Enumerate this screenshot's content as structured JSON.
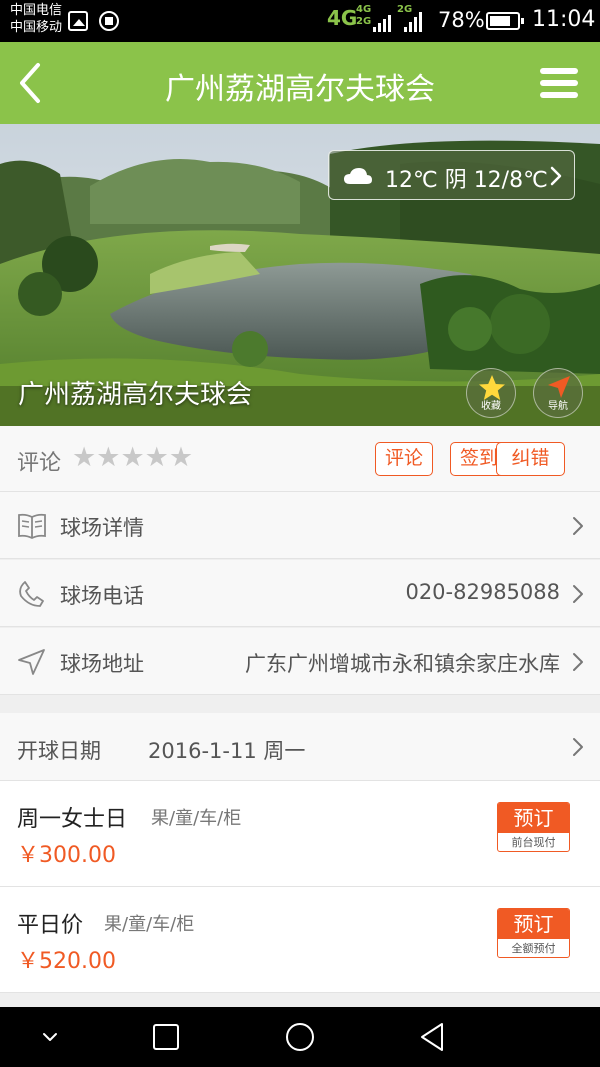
{
  "status_bar": {
    "carrier1": "中国电信",
    "carrier2": "中国移动",
    "network_main": "4G",
    "network_a": "4G",
    "network_b": "2G",
    "network_c": "2G",
    "battery_percent": "78%",
    "battery_level": 0.78,
    "time": "11:04"
  },
  "app_bar": {
    "title": "广州荔湖高尔夫球会",
    "back_icon": "back-arrow-icon",
    "menu_icon": "hamburger-menu-icon"
  },
  "hero": {
    "weather": "12℃  阴 12/8℃",
    "weather_icon": "cloud-icon",
    "course_name": "广州荔湖高尔夫球会",
    "favorite_label": "收藏",
    "navigate_label": "导航"
  },
  "rating": {
    "label": "评论",
    "stars": 0,
    "max_stars": 5,
    "comment_btn": "评论",
    "checkin_btn": "签到",
    "correct_btn": "纠错"
  },
  "info": {
    "details_label": "球场详情",
    "phone_label": "球场电话",
    "phone_value": "020-82985088",
    "address_label": "球场地址",
    "address_value": "广东广州增城市永和镇余家庄水库"
  },
  "date": {
    "label": "开球日期",
    "value": "2016-1-11 周一"
  },
  "prices": [
    {
      "name": "周一女士日",
      "tags": "果/童/车/柜",
      "price": "￥300.00",
      "book": "预订",
      "pay": "前台现付"
    },
    {
      "name": "平日价",
      "tags": "果/童/车/柜",
      "price": "￥520.00",
      "book": "预订",
      "pay": "全额预付"
    }
  ],
  "colors": {
    "brand_green": "#8bc34a",
    "accent_orange": "#f05a24"
  }
}
